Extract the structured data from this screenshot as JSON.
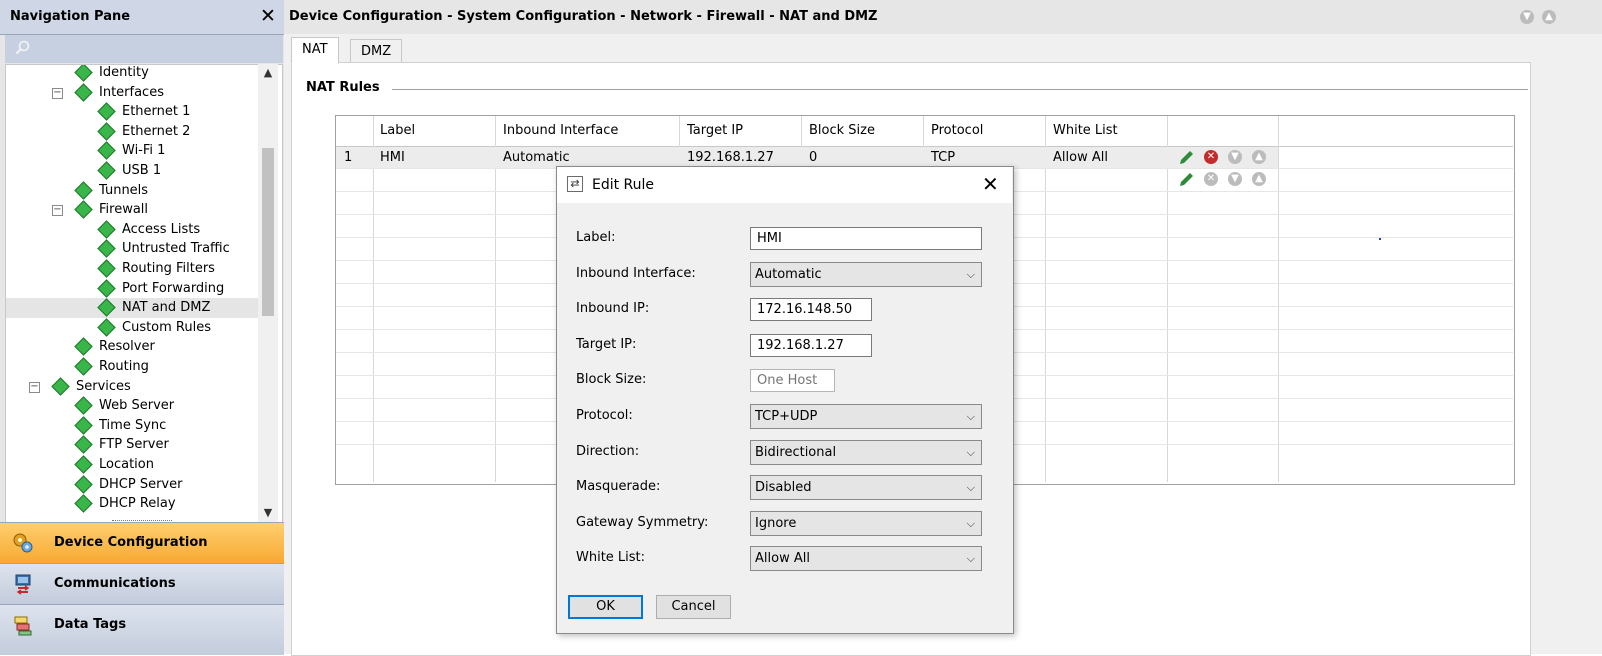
{
  "nav": {
    "title": "Navigation Pane",
    "tree": [
      {
        "label": "Identity"
      },
      {
        "label": "Interfaces",
        "toggle": "⊟"
      },
      {
        "label": "Ethernet 1"
      },
      {
        "label": "Ethernet 2"
      },
      {
        "label": "Wi-Fi 1"
      },
      {
        "label": "USB 1"
      },
      {
        "label": "Tunnels"
      },
      {
        "label": "Firewall",
        "toggle": "⊟"
      },
      {
        "label": "Access Lists"
      },
      {
        "label": "Untrusted Traffic"
      },
      {
        "label": "Routing Filters"
      },
      {
        "label": "Port Forwarding"
      },
      {
        "label": "NAT and DMZ"
      },
      {
        "label": "Custom Rules"
      },
      {
        "label": "Resolver"
      },
      {
        "label": "Routing"
      },
      {
        "label": "Services",
        "toggle": "⊟"
      },
      {
        "label": "Web Server"
      },
      {
        "label": "Time Sync"
      },
      {
        "label": "FTP Server"
      },
      {
        "label": "Location"
      },
      {
        "label": "DHCP Server"
      },
      {
        "label": "DHCP Relay"
      }
    ],
    "buttons": [
      {
        "label": "Device Configuration",
        "icon": "device-config-icon"
      },
      {
        "label": "Communications",
        "icon": "communications-icon"
      },
      {
        "label": "Data Tags",
        "icon": "data-tags-icon"
      }
    ]
  },
  "main": {
    "title": "Device Configuration - System Configuration - Network - Firewall - NAT and DMZ",
    "tabs": [
      {
        "label": "NAT"
      },
      {
        "label": "DMZ"
      }
    ],
    "group_label": "NAT Rules",
    "grid": {
      "columns": [
        "Label",
        "Inbound Interface",
        "Target IP",
        "Block Size",
        "Protocol",
        "White List"
      ],
      "rows": [
        {
          "num": "1",
          "label": "HMI",
          "inbound": "Automatic",
          "target": "192.168.1.27",
          "block": "0",
          "protocol": "TCP",
          "whitelist": "Allow All"
        }
      ]
    }
  },
  "dialog": {
    "title": "Edit Rule",
    "fields": {
      "label": {
        "label": "Label:",
        "value": "HMI"
      },
      "inbound_interface": {
        "label": "Inbound Interface:",
        "value": "Automatic"
      },
      "inbound_ip": {
        "label": "Inbound IP:",
        "value": "172.16.148.50"
      },
      "target_ip": {
        "label": "Target IP:",
        "value": "192.168.1.27"
      },
      "block_size": {
        "label": "Block Size:",
        "placeholder": "One Host"
      },
      "protocol": {
        "label": "Protocol:",
        "value": "TCP+UDP"
      },
      "direction": {
        "label": "Direction:",
        "value": "Bidirectional"
      },
      "masquerade": {
        "label": "Masquerade:",
        "value": "Disabled"
      },
      "gateway_symmetry": {
        "label": "Gateway Symmetry:",
        "value": "Ignore"
      },
      "white_list": {
        "label": "White List:",
        "value": "Allow All"
      }
    },
    "ok_label": "OK",
    "cancel_label": "Cancel"
  },
  "colors": {
    "accent_active": "#f7a932",
    "tree_icon": "#39b54a",
    "edit_icon": "#2e8b3a",
    "delete_icon": "#c42b2b"
  }
}
